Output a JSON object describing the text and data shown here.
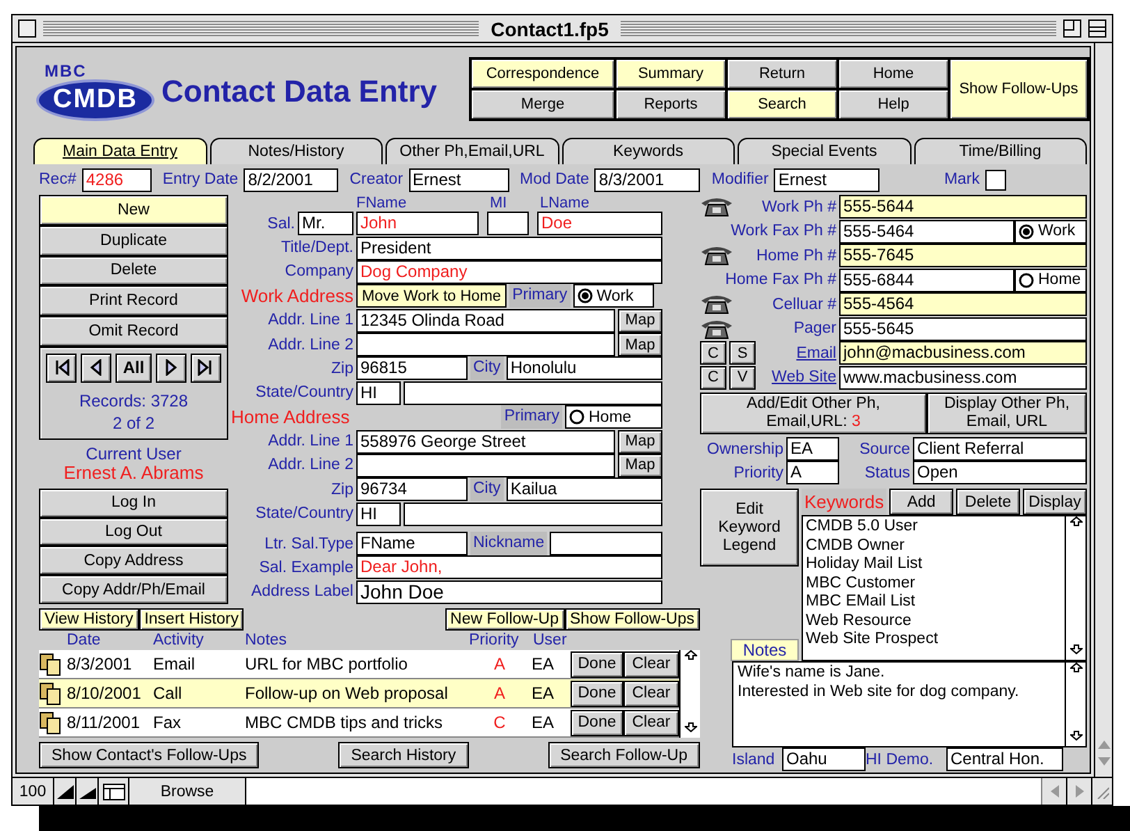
{
  "window": {
    "title": "Contact1.fp5"
  },
  "header": {
    "logo": {
      "top": "MBC",
      "main": "CMDB"
    },
    "title": "Contact Data Entry",
    "nav_buttons": [
      {
        "label": "Correspondence",
        "highlighted": true
      },
      {
        "label": "Summary",
        "highlighted": true
      },
      {
        "label": "Return",
        "highlighted": false
      },
      {
        "label": "Home",
        "highlighted": false
      },
      {
        "label": "Merge",
        "highlighted": false
      },
      {
        "label": "Reports",
        "highlighted": false
      },
      {
        "label": "Search",
        "highlighted": true
      },
      {
        "label": "Help",
        "highlighted": false
      }
    ],
    "follow_ups_button": {
      "label": "Show Follow-Ups",
      "highlighted": true
    }
  },
  "tabs": [
    {
      "label": "Main Data Entry",
      "selected": true
    },
    {
      "label": "Notes/History",
      "selected": false
    },
    {
      "label": "Other Ph,Email,URL",
      "selected": false
    },
    {
      "label": "Keywords",
      "selected": false
    },
    {
      "label": "Special Events",
      "selected": false
    },
    {
      "label": "Time/Billing",
      "selected": false
    }
  ],
  "record_bar": {
    "fields": [
      {
        "label": "Rec#",
        "value": "4286",
        "alert": true
      },
      {
        "label": "Entry Date",
        "value": "8/2/2001",
        "alert": false
      },
      {
        "label": "Creator",
        "value": "Ernest",
        "alert": false
      },
      {
        "label": "Mod Date",
        "value": "8/3/2001",
        "alert": false
      },
      {
        "label": "Modifier",
        "value": "Ernest",
        "alert": false
      }
    ],
    "mark": {
      "label": "Mark",
      "checked": false
    }
  },
  "record_buttons": [
    {
      "label": "New",
      "highlighted": true
    },
    {
      "label": "Duplicate",
      "highlighted": false
    },
    {
      "label": "Delete",
      "highlighted": false
    },
    {
      "label": "Print Record",
      "highlighted": false
    },
    {
      "label": "Omit Record",
      "highlighted": false
    }
  ],
  "record_nav": {
    "all_label": "All",
    "count": "Records: 3728",
    "position": "2 of 2"
  },
  "current_user": {
    "label": "Current User",
    "name": "Ernest A. Abrams"
  },
  "user_buttons": [
    "Log In",
    "Log Out",
    "Copy Address",
    "Copy Addr/Ph/Email"
  ],
  "name": {
    "headings": {
      "first": "FName",
      "middle": "MI",
      "last": "LName"
    },
    "salutation_label": "Sal.",
    "salutation": {
      "value": "Mr."
    },
    "first": {
      "value": "John",
      "alert": true
    },
    "last": {
      "value": "Doe",
      "alert": true
    }
  },
  "title_dept": {
    "label": "Title/Dept.",
    "value": "President"
  },
  "company": {
    "label": "Company",
    "value": "Dog Company",
    "alert": true
  },
  "work_address": {
    "heading": "Work Address",
    "move_button": "Move Work to Home",
    "primary_label": "Primary",
    "primary_option": {
      "label": "Work",
      "selected": true
    },
    "line1": {
      "label": "Addr. Line 1",
      "value": "12345 Olinda Road",
      "map": "Map"
    },
    "line2": {
      "label": "Addr. Line 2",
      "map": "Map"
    },
    "zip": {
      "label": "Zip",
      "value": "96815"
    },
    "city": {
      "label": "City",
      "value": "Honolulu"
    },
    "state": {
      "label": "State/Country",
      "value": "HI"
    }
  },
  "home_address": {
    "heading": "Home Address",
    "primary_label": "Primary",
    "primary_option": {
      "label": "Home",
      "selected": false
    },
    "line1": {
      "label": "Addr. Line 1",
      "value": "558976 George Street",
      "map": "Map"
    },
    "line2": {
      "label": "Addr. Line 2",
      "map": "Map"
    },
    "zip": {
      "label": "Zip",
      "value": "96734"
    },
    "city": {
      "label": "City",
      "value": "Kailua"
    },
    "state": {
      "label": "State/Country",
      "value": "HI"
    }
  },
  "letter": {
    "sal_type": {
      "label": "Ltr. Sal.Type",
      "value": "FName"
    },
    "nickname": {
      "label": "Nickname"
    },
    "sal_example": {
      "label": "Sal. Example",
      "value": "Dear John,",
      "alert": true
    },
    "address_label": {
      "label": "Address Label",
      "value": "John Doe"
    }
  },
  "contact_points": [
    {
      "kind": "phone",
      "label": "Work Ph #",
      "value": "555-5644",
      "highlighted": true
    },
    {
      "kind": "fax",
      "label": "Work Fax Ph #",
      "value": "555-5464",
      "highlighted": false,
      "primary_option": {
        "label": "Work",
        "selected": true
      }
    },
    {
      "kind": "phone",
      "label": "Home Ph #",
      "value": "555-7645",
      "highlighted": true
    },
    {
      "kind": "fax",
      "label": "Home Fax Ph #",
      "value": "555-6844",
      "highlighted": false,
      "primary_option": {
        "label": "Home",
        "selected": false
      }
    },
    {
      "kind": "phone",
      "label": "Celluar #",
      "value": "555-4564",
      "highlighted": true
    },
    {
      "kind": "phone",
      "label": "Pager",
      "value": "555-5645",
      "highlighted": false
    },
    {
      "kind": "link",
      "label": "Email",
      "value": "john@macbusiness.com",
      "highlighted": true,
      "buttons": [
        "C",
        "S"
      ]
    },
    {
      "kind": "link",
      "label": "Web Site",
      "value": "www.macbusiness.com",
      "highlighted": false,
      "buttons": [
        "C",
        "V"
      ]
    }
  ],
  "other_contacts": {
    "edit_button": {
      "label": "Add/Edit Other Ph, Email,URL:",
      "count": "3"
    },
    "display_button": "Display Other Ph, Email, URL"
  },
  "classification": [
    {
      "label": "Ownership",
      "value": "EA"
    },
    {
      "label": "Source",
      "value": "Client Referral"
    },
    {
      "label": "Priority",
      "value": "A"
    },
    {
      "label": "Status",
      "value": "Open"
    }
  ],
  "keywords": {
    "legend_button": "Edit Keyword Legend",
    "heading": "Keywords",
    "buttons": [
      "Add",
      "Delete",
      "Display"
    ],
    "items": [
      "CMDB 5.0 User",
      "CMDB Owner",
      "Holiday Mail List",
      "MBC Customer",
      "MBC EMail List",
      "Web Resource",
      "Web Site Prospect"
    ]
  },
  "notes": {
    "heading": "Notes",
    "lines": [
      "Wife's name is Jane.",
      "Interested in Web site for dog company."
    ]
  },
  "demographics": [
    {
      "label": "Island",
      "value": "Oahu"
    },
    {
      "label": "HI Demo.",
      "value": "Central Hon."
    }
  ],
  "history": {
    "left_buttons": [
      "View History",
      "Insert History"
    ],
    "right_buttons": [
      "New Follow-Up",
      "Show Follow-Ups"
    ],
    "columns": [
      "Date",
      "Activity",
      "Notes",
      "Priority",
      "User"
    ],
    "rows": [
      {
        "date": "8/3/2001",
        "activity": "Email",
        "notes": "URL for MBC portfolio",
        "priority": "A",
        "user": "EA",
        "done": "Done",
        "clear": "Clear",
        "highlighted": false
      },
      {
        "date": "8/10/2001",
        "activity": "Call",
        "notes": "Follow-up on Web proposal",
        "priority": "A",
        "user": "EA",
        "done": "Done",
        "clear": "Clear",
        "highlighted": true
      },
      {
        "date": "8/11/2001",
        "activity": "Fax",
        "notes": "MBC CMDB tips and tricks",
        "priority": "C",
        "user": "EA",
        "done": "Done",
        "clear": "Clear",
        "highlighted": false
      }
    ],
    "footer_buttons": [
      "Show Contact's Follow-Ups",
      "Search History",
      "Search Follow-Up"
    ]
  },
  "status_bar": {
    "zoom": "100",
    "mode": "Browse"
  }
}
